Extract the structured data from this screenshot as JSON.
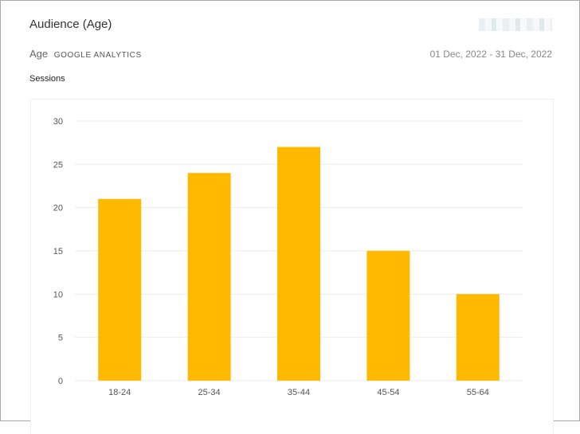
{
  "header": {
    "title": "Audience (Age)",
    "dimension": "Age",
    "source": "GOOGLE ANALYTICS",
    "date_range": "01 Dec, 2022 - 31 Dec, 2022"
  },
  "metric_label": "Sessions",
  "colors": {
    "bar": "#FFB900",
    "grid": "#ebebeb"
  },
  "chart_data": {
    "type": "bar",
    "categories": [
      "18-24",
      "25-34",
      "35-44",
      "45-54",
      "55-64"
    ],
    "values": [
      21,
      24,
      27,
      15,
      10
    ],
    "ylim": [
      0,
      30
    ],
    "yticks": [
      0,
      5,
      10,
      15,
      20,
      25,
      30
    ],
    "grid": true
  }
}
